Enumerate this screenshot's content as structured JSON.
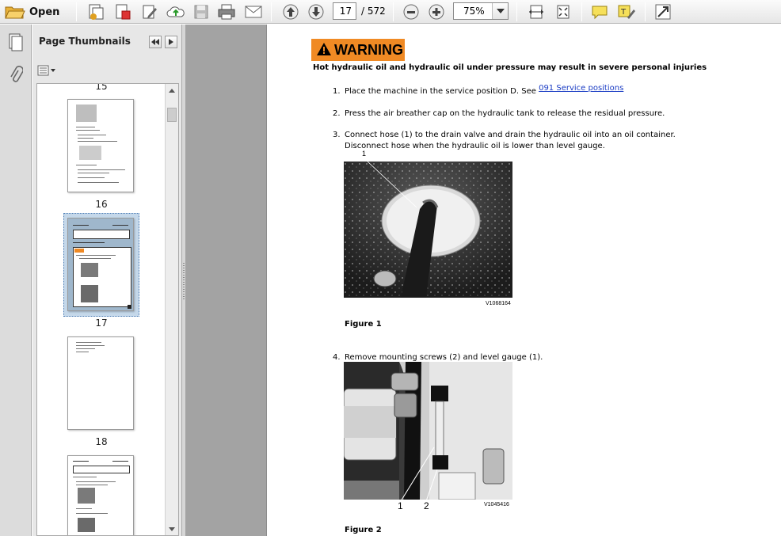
{
  "toolbar": {
    "open_label": "Open",
    "current_page": "17",
    "page_total": "/ 572",
    "zoom": "75%"
  },
  "panel": {
    "title": "Page Thumbnails",
    "pages": [
      {
        "number": "15"
      },
      {
        "number": "16"
      },
      {
        "number": "17"
      },
      {
        "number": "18"
      }
    ]
  },
  "document": {
    "warning_label": "WARNING",
    "hazard_text": "Hot hydraulic oil and hydraulic oil under pressure may result in severe personal injuries",
    "steps": [
      {
        "number": "1.",
        "text": "Place the machine in the service position D. See ",
        "link": "091 Service positions"
      },
      {
        "number": "2.",
        "text": "Press the air breather cap on the hydraulic tank to release the residual pressure."
      },
      {
        "number": "3.",
        "text": "Connect hose (1) to the drain valve and drain the hydraulic oil into an oil container.",
        "text2": "Disconnect hose when the hydraulic oil is lower than level gauge."
      },
      {
        "number": "4.",
        "text": "Remove mounting screws (2) and level gauge (1)."
      }
    ],
    "figure1": {
      "code": "V1068164",
      "caption": "Figure 1",
      "callout": "1"
    },
    "figure2": {
      "code": "V1045416",
      "caption": "Figure 2",
      "callout1": "1",
      "callout2": "2"
    }
  },
  "colors": {
    "warning": "#f08a24",
    "link": "#1a3cc4",
    "selection": "#c5d8ea"
  }
}
